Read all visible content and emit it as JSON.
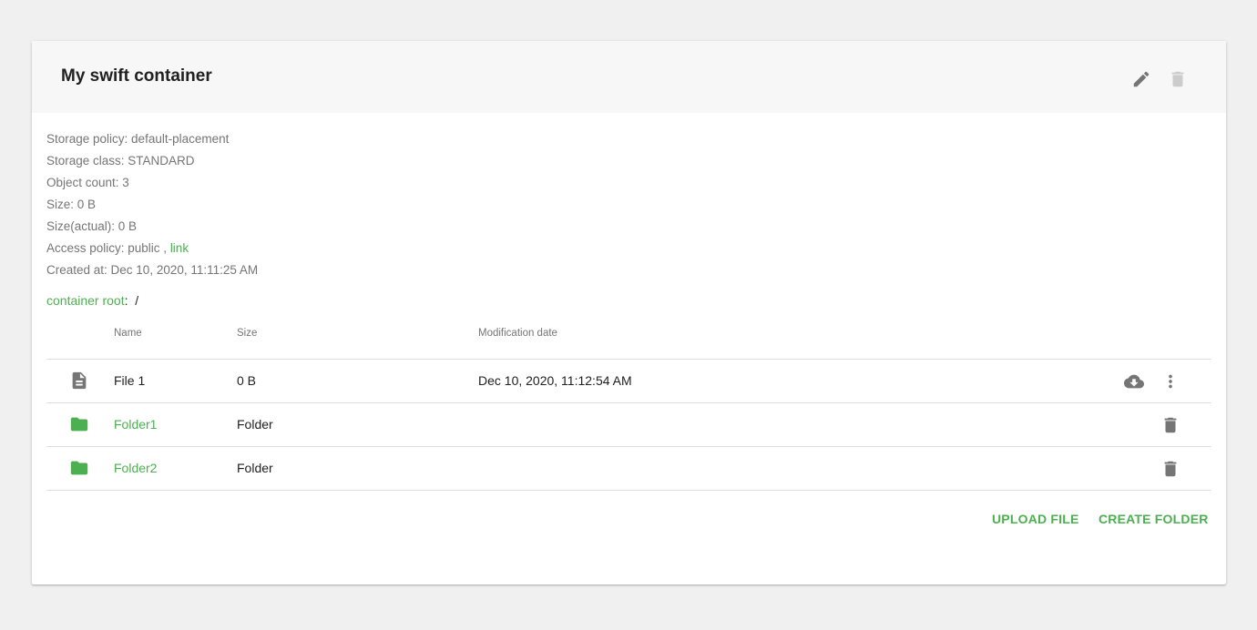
{
  "container": {
    "title": "My swift container",
    "edit_icon": "pencil-icon",
    "delete_icon": "trash-icon"
  },
  "info": {
    "storage_policy": "Storage policy: default-placement",
    "storage_class": "Storage class: STANDARD",
    "object_count": "Object count: 3",
    "size": "Size: 0 B",
    "size_actual": "Size(actual): 0 B",
    "access_policy_prefix": "Access policy: public , ",
    "access_policy_link": "link",
    "created_at": "Created at: Dec 10, 2020, 11:11:25 AM"
  },
  "breadcrumb": {
    "root_label": "container root",
    "separator": ":",
    "path": "/"
  },
  "table": {
    "columns": {
      "name": "Name",
      "size": "Size",
      "modified": "Modification date"
    },
    "rows": [
      {
        "icon": "file-icon",
        "name": "File 1",
        "size": "0 B",
        "modified": "Dec 10, 2020, 11:12:54 AM",
        "type": "file"
      },
      {
        "icon": "folder-icon",
        "name": "Folder1",
        "size": "Folder",
        "modified": "",
        "type": "folder"
      },
      {
        "icon": "folder-icon",
        "name": "Folder2",
        "size": "Folder",
        "modified": "",
        "type": "folder"
      }
    ]
  },
  "actions": {
    "upload_file": "UPLOAD FILE",
    "create_folder": "CREATE FOLDER"
  },
  "colors": {
    "accent": "#4caf50",
    "icon_grey": "#757575",
    "disabled_grey": "#cccccc",
    "background": "#f0f0f0"
  }
}
